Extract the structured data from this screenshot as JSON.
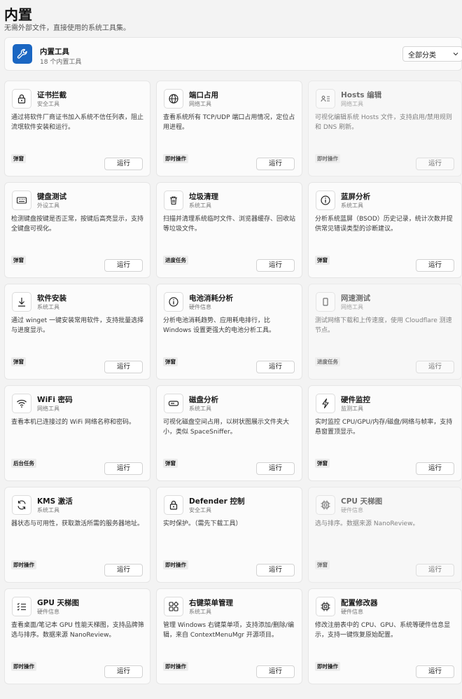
{
  "header": {
    "title": "内置",
    "subtitle": "无需外部文件，直接使用的系统工具集。"
  },
  "summary": {
    "title": "内置工具",
    "count": "18 个内置工具",
    "icon": "wrench-icon",
    "icon_color": "#1a66c2",
    "category": "全部分类"
  },
  "tools": [
    {
      "name": "证书拦截",
      "category": "安全工具",
      "desc": "通过将软件厂商证书加入系统不信任列表，阻止流氓软件安装和运行。",
      "tag": "弹窗",
      "action": "运行",
      "icon": "lock-icon"
    },
    {
      "name": "端口占用",
      "category": "网络工具",
      "desc": "查看系统所有 TCP/UDP 端口占用情况，定位占用进程。",
      "tag": "即时操作",
      "action": "运行",
      "icon": "globe-icon"
    },
    {
      "name": "Hosts 编辑",
      "category": "网络工具",
      "desc": "可视化编辑系统 Hosts 文件，支持启用/禁用规则和 DNS 刷新。",
      "tag": "即时操作",
      "action": "运行",
      "icon": "hosts-icon"
    },
    {
      "name": "键盘测试",
      "category": "外设工具",
      "desc": "检测键盘按键是否正常，按键后高亮显示，支持全键盘可视化。",
      "tag": "弹窗",
      "action": "运行",
      "icon": "keyboard-icon"
    },
    {
      "name": "垃圾清理",
      "category": "系统工具",
      "desc": "扫描并清理系统临时文件、浏览器缓存、回收站等垃圾文件。",
      "tag": "进度任务",
      "action": "运行",
      "icon": "trash-icon"
    },
    {
      "name": "蓝屏分析",
      "category": "系统工具",
      "desc": "分析系统蓝屏（BSOD）历史记录，统计次数并提供常见错误类型的诊断建议。",
      "tag": "弹窗",
      "action": "运行",
      "icon": "info-icon"
    },
    {
      "name": "软件安装",
      "category": "系统工具",
      "desc": "通过 winget 一键安装常用软件，支持批量选择与进度显示。",
      "tag": "弹窗",
      "action": "运行",
      "icon": "download-icon"
    },
    {
      "name": "电池消耗分析",
      "category": "硬件信息",
      "desc": "分析电池消耗趋势、应用耗电排行，比 Windows 设置更强大的电池分析工具。",
      "tag": "弹窗",
      "action": "运行",
      "icon": "info-icon"
    },
    {
      "name": "网速测试",
      "category": "网络工具",
      "desc": "测试网络下载和上传速度，使用 Cloudflare 测速节点。",
      "tag": "进度任务",
      "action": "运行",
      "icon": "phone-icon"
    },
    {
      "name": "WiFi 密码",
      "category": "网络工具",
      "desc": "查看本机已连接过的 WiFi 网络名称和密码。",
      "tag": "后台任务",
      "action": "运行",
      "icon": "wifi-icon"
    },
    {
      "name": "磁盘分析",
      "category": "系统工具",
      "desc": "可视化磁盘空间占用，以树状图展示文件夹大小，类似 SpaceSniffer。",
      "tag": "弹窗",
      "action": "运行",
      "icon": "disk-icon"
    },
    {
      "name": "硬件监控",
      "category": "监测工具",
      "desc": "实时监控 CPU/GPU/内存/磁盘/网络与帧率，支持悬窗置顶显示。",
      "tag": "弹窗",
      "action": "运行",
      "icon": "lightning-icon"
    },
    {
      "name": "KMS 激活",
      "category": "系统工具",
      "desc": "器状态与可用性，获取激活所需的服务器地址。",
      "tag": "即时操作",
      "action": "运行",
      "icon": "refresh-icon"
    },
    {
      "name": "Defender 控制",
      "category": "安全工具",
      "desc": "实时保护。（需先下载工具）",
      "tag": "即时操作",
      "action": "运行",
      "icon": "lock-icon"
    },
    {
      "name": "CPU 天梯图",
      "category": "硬件信息",
      "desc": "选与排序。数据来源 NanoReview。",
      "tag": "弹窗",
      "action": "运行",
      "icon": "chip-icon"
    },
    {
      "name": "GPU 天梯图",
      "category": "硬件信息",
      "desc": "查看桌面/笔记本 GPU 性能天梯图，支持品牌筛选与排序。数据来源 NanoReview。",
      "tag": "即时操作",
      "action": "运行",
      "icon": "list-icon"
    },
    {
      "name": "右键菜单管理",
      "category": "系统工具",
      "desc": "管理 Windows 右键菜单项，支持添加/删除/编辑，来自 ContextMenuMgr 开源项目。",
      "tag": "即时操作",
      "action": "运行",
      "icon": "apps-icon"
    },
    {
      "name": "配置修改器",
      "category": "硬件信息",
      "desc": "修改注册表中的 CPU、GPU、系统等硬件信息显示，支持一键恢复原始配置。",
      "tag": "即时操作",
      "action": "运行",
      "icon": "chip-icon"
    }
  ]
}
